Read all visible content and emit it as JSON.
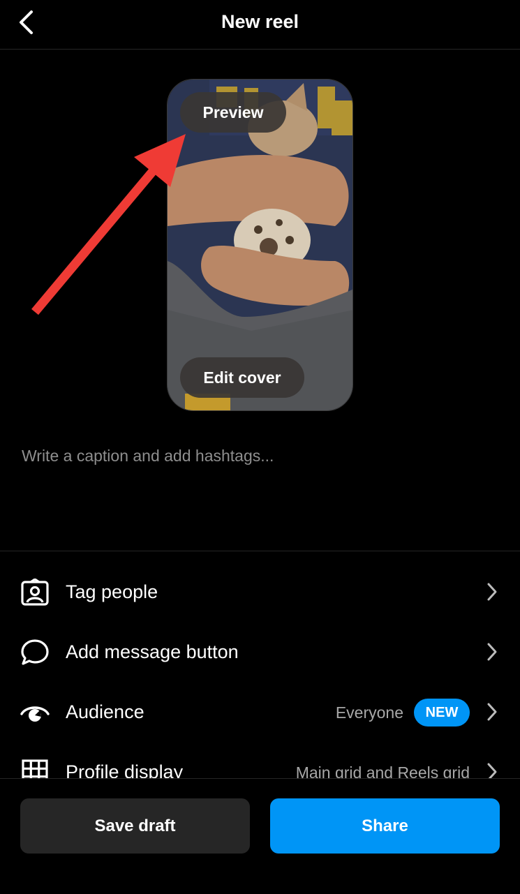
{
  "header": {
    "title": "New reel"
  },
  "cover": {
    "preview_label": "Preview",
    "edit_label": "Edit cover"
  },
  "caption": {
    "placeholder": "Write a caption and add hashtags..."
  },
  "options": [
    {
      "label": "Tag people",
      "icon": "tag-people-icon"
    },
    {
      "label": "Add message button",
      "icon": "message-bubble-icon"
    },
    {
      "label": "Audience",
      "icon": "audience-eye-icon",
      "value": "Everyone",
      "badge": "NEW"
    },
    {
      "label": "Profile display",
      "icon": "grid-icon",
      "value": "Main grid and Reels grid"
    }
  ],
  "actions": {
    "save_draft": "Save draft",
    "share": "Share"
  },
  "colors": {
    "accent": "#0095f6",
    "annotation_arrow": "#ef3b35",
    "background": "#000000"
  }
}
